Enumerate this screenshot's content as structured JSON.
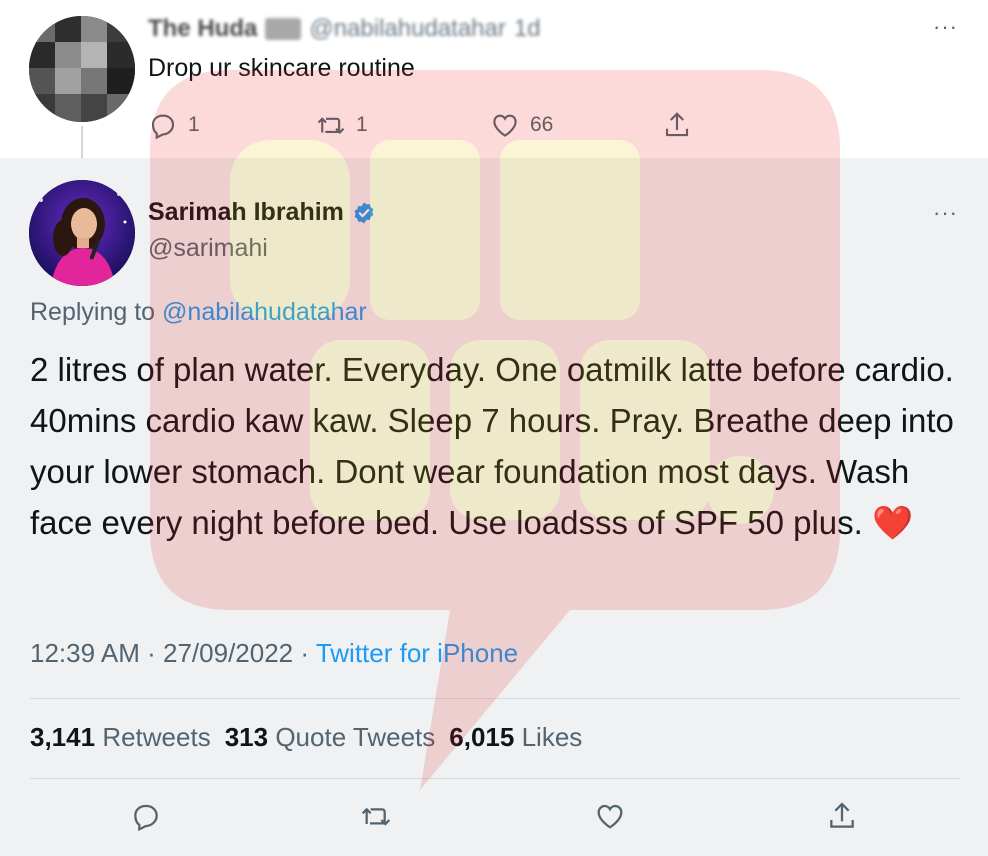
{
  "parent_tweet": {
    "author_name": "The Huda",
    "author_handle": "@nabilahudatahar",
    "time": "1d",
    "text": "Drop ur skincare routine",
    "more_label": "···",
    "reply_count": "1",
    "retweet_count": "1",
    "like_count": "66"
  },
  "main_tweet": {
    "author_name": "Sarimah Ibrahim",
    "author_handle": "@sarimahi",
    "verified": true,
    "more_label": "···",
    "replying_label": "Replying to",
    "replying_handle": "@nabilahudatahar",
    "body": "2 litres of plan water. Everyday. One oatmilk latte before cardio. 40mins cardio kaw kaw. Sleep 7 hours. Pray. Breathe deep into your lower stomach. Dont wear foundation most days. Wash face every night before bed. Use loadsss of SPF 50 plus.",
    "emoji": "❤️",
    "time": "12:39 AM",
    "separator": "·",
    "date": "27/09/2022",
    "source": "Twitter for iPhone",
    "stats": {
      "retweets_count": "3,141",
      "retweets_label": "Retweets",
      "quotes_count": "313",
      "quotes_label": "Quote Tweets",
      "likes_count": "6,015",
      "likes_label": "Likes"
    }
  },
  "colors": {
    "link": "#1d9bf0",
    "muted": "#536471",
    "verified": "#1d9bf0",
    "heart": "#e0245e",
    "main_bg": "#eff1f3"
  },
  "icons": [
    "reply-icon",
    "retweet-icon",
    "like-icon",
    "share-icon",
    "verified-badge-icon",
    "more-icon"
  ]
}
